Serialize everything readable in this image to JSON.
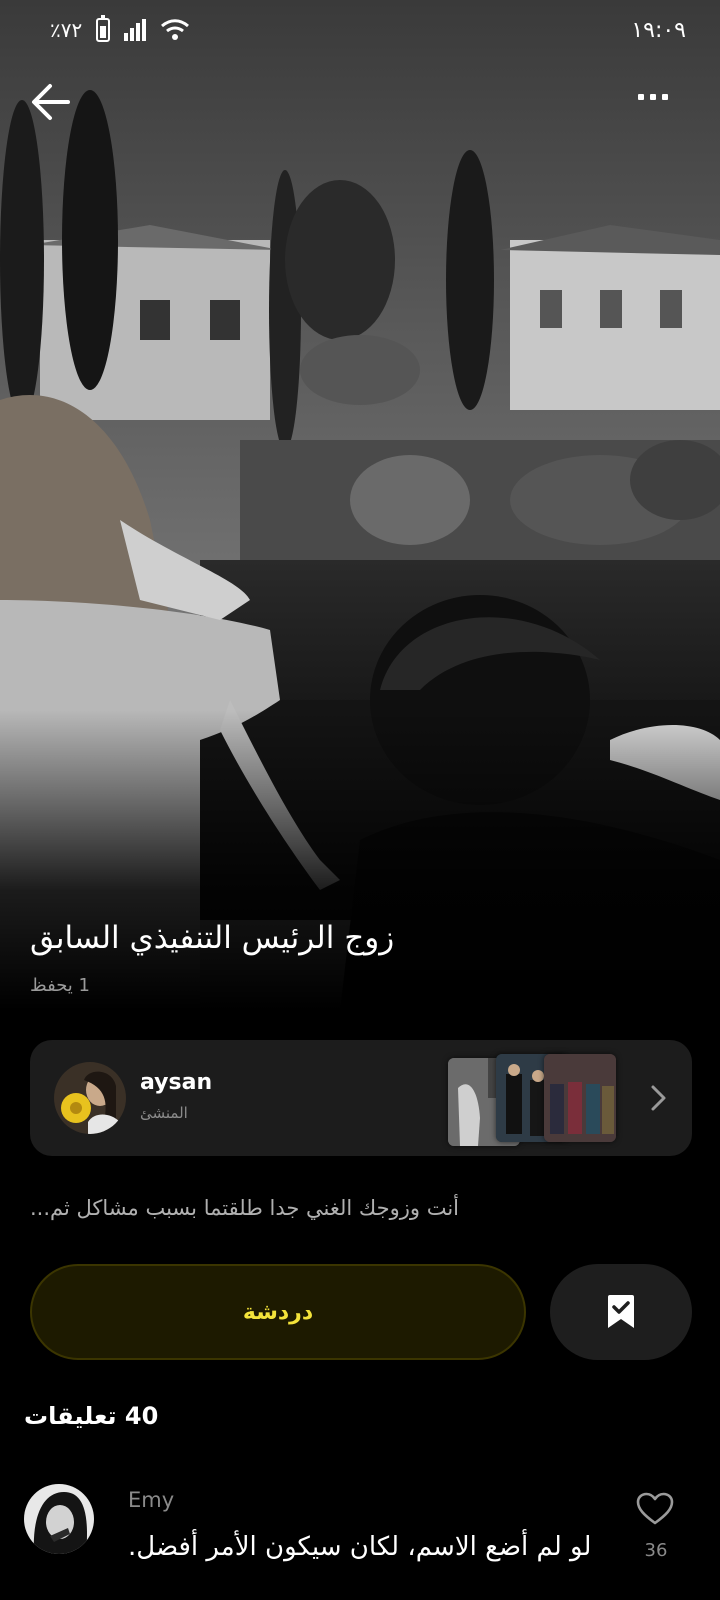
{
  "status_bar": {
    "time": "١٩:٠٩",
    "battery": "٪٧٢"
  },
  "story": {
    "title": "زوج الرئيس التنفيذي السابق",
    "saves": "1 يحفظ",
    "description": "أنت وزوجك الغني جدا طلقتما بسبب مشاكل ثم..."
  },
  "creator": {
    "name": "aysan",
    "role": "المنشئ"
  },
  "actions": {
    "chat_label": "دردشة"
  },
  "comments": {
    "count_label": "40 تعليقات",
    "items": [
      {
        "author": "Emy",
        "text": "لو لم أضع الاسم، لكان سيكون الأمر أفضل.",
        "likes": "36"
      }
    ]
  },
  "icons": {
    "back": "arrow-left-icon",
    "more": "more-dots-icon",
    "chevron": "chevron-right-icon",
    "save": "bookmark-check-icon",
    "like": "heart-outline-icon"
  },
  "colors": {
    "chat_text": "#f3e33a",
    "chat_bg": "#1d1a00"
  }
}
